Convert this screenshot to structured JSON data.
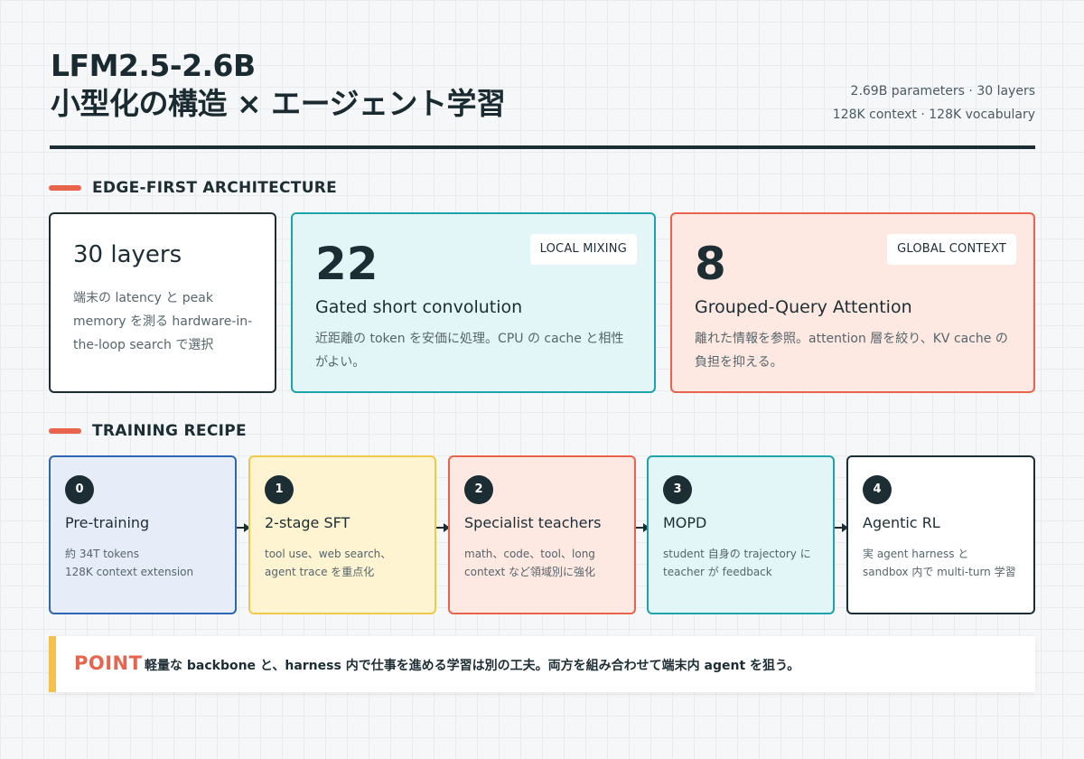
{
  "header": {
    "title_line1": "LFM2.5-2.6B",
    "title_line2": "小型化の構造 × エージェント学習",
    "meta_line1": "2.69B parameters · 30 layers",
    "meta_line2": "128K context · 128K vocabulary"
  },
  "architecture": {
    "section_title": "EDGE-FIRST ARCHITECTURE",
    "layers_card": {
      "title": "30 layers",
      "desc": "端末の latency と peak memory を測る hardware-in-the-loop search で選択"
    },
    "conv_card": {
      "number": "22",
      "tag": "LOCAL MIXING",
      "title": "Gated short convolution",
      "desc": "近距離の token を安価に処理。CPU の cache と相性がよい。"
    },
    "attn_card": {
      "number": "8",
      "tag": "GLOBAL CONTEXT",
      "title": "Grouped-Query Attention",
      "desc": "離れた情報を参照。attention 層を絞り、KV cache の負担を抑える。"
    }
  },
  "training": {
    "section_title": "TRAINING RECIPE",
    "steps": [
      {
        "num": "0",
        "title": "Pre-training",
        "desc_line1": "約 34T tokens",
        "desc_line2": "128K context extension"
      },
      {
        "num": "1",
        "title": "2-stage SFT",
        "desc_line1": "tool use、web search、",
        "desc_line2": "agent trace を重点化"
      },
      {
        "num": "2",
        "title": "Specialist teachers",
        "desc_line1": "math、code、tool、long",
        "desc_line2": "context など領域別に強化"
      },
      {
        "num": "3",
        "title": "MOPD",
        "desc_line1": "student 自身の trajectory に",
        "desc_line2": "teacher が feedback"
      },
      {
        "num": "4",
        "title": "Agentic RL",
        "desc_line1": "実 agent harness と",
        "desc_line2": "sandbox 内で multi-turn 学習"
      }
    ]
  },
  "point": {
    "label": "POINT",
    "text": "軽量な backbone と、harness 内で仕事を進める学習は別の工夫。両方を組み合わせて端末内 agent を狙う。"
  },
  "colors": {
    "accent_red": "#e8644c",
    "accent_teal": "#1ea3ad",
    "accent_blue": "#2f66b0",
    "accent_yellow": "#f2c14e",
    "ink": "#1d2d34"
  }
}
